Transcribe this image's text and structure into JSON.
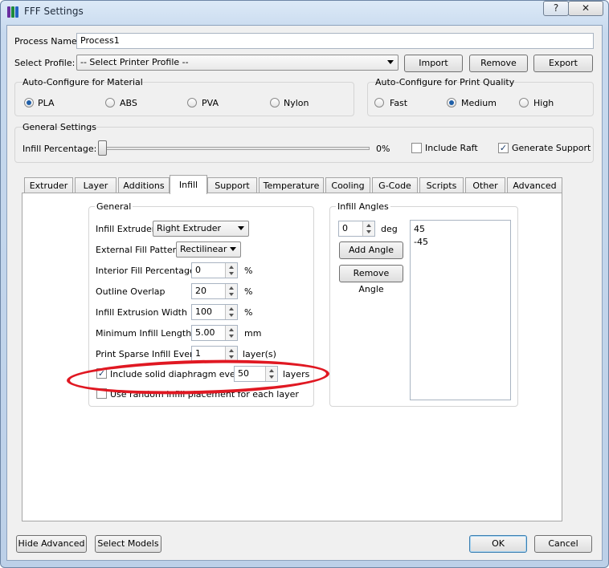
{
  "window": {
    "title": "FFF Settings",
    "help_btn": "?",
    "close_btn": "✕"
  },
  "process": {
    "label": "Process Name:",
    "value": "Process1"
  },
  "profile": {
    "label": "Select Profile:",
    "value": "-- Select Printer Profile --",
    "import": "Import",
    "remove": "Remove",
    "export": "Export"
  },
  "material": {
    "title": "Auto-Configure for Material",
    "options": [
      "PLA",
      "ABS",
      "PVA",
      "Nylon"
    ],
    "selected": "PLA"
  },
  "quality": {
    "title": "Auto-Configure for Print Quality",
    "options": [
      "Fast",
      "Medium",
      "High"
    ],
    "selected": "Medium"
  },
  "general_settings": {
    "title": "General Settings",
    "infill_label": "Infill Percentage:",
    "infill_value": "0%",
    "infill_fraction": 0,
    "include_raft": "Include Raft",
    "include_raft_checked": false,
    "generate_support": "Generate Support",
    "generate_support_checked": true
  },
  "tabs": [
    "Extruder",
    "Layer",
    "Additions",
    "Infill",
    "Support",
    "Temperature",
    "Cooling",
    "G-Code",
    "Scripts",
    "Other",
    "Advanced"
  ],
  "active_tab": "Infill",
  "infill_general": {
    "title": "General",
    "infill_extruder": {
      "label": "Infill Extruder",
      "value": "Right Extruder"
    },
    "external_fill_pattern": {
      "label": "External Fill Pattern",
      "value": "Rectilinear"
    },
    "interior_fill_percentage": {
      "label": "Interior Fill Percentage",
      "value": "0",
      "unit": "%"
    },
    "outline_overlap": {
      "label": "Outline Overlap",
      "value": "20",
      "unit": "%"
    },
    "infill_extrusion_width": {
      "label": "Infill Extrusion Width",
      "value": "100",
      "unit": "%"
    },
    "minimum_infill_length": {
      "label": "Minimum Infill Length",
      "value": "5.00",
      "unit": "mm"
    },
    "print_sparse_infill": {
      "label": "Print Sparse Infill Every",
      "value": "1",
      "unit": "layer(s)"
    },
    "solid_diaphragm": {
      "label": "Include solid diaphragm every",
      "value": "50",
      "unit": "layers",
      "checked": true
    },
    "random_infill": {
      "label": "Use random infill placement for each layer",
      "checked": false
    }
  },
  "infill_angles": {
    "title": "Infill Angles",
    "value": "0",
    "unit": "deg",
    "add": "Add Angle",
    "remove": "Remove Angle",
    "list": [
      "45",
      "-45"
    ]
  },
  "footer": {
    "hide_advanced": "Hide Advanced",
    "select_models": "Select Models",
    "ok": "OK",
    "cancel": "Cancel"
  },
  "colors": {
    "annotation_ring": "#e01822",
    "window_frame": "#c7d9ee"
  }
}
